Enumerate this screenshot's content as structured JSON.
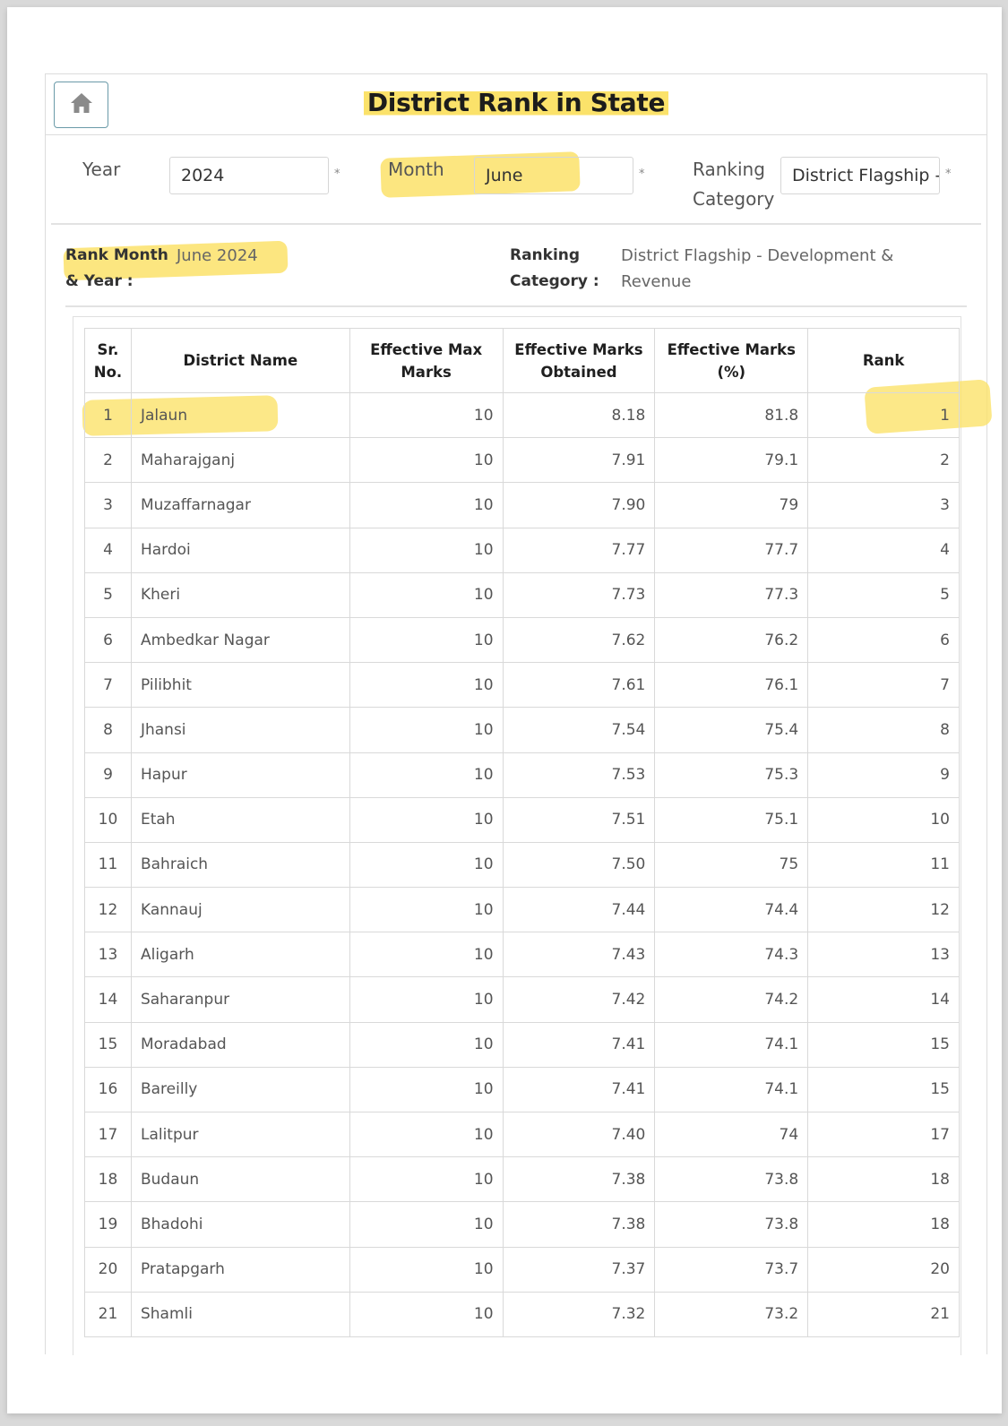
{
  "header": {
    "title": "District Rank in State",
    "home_icon": "home-icon"
  },
  "filters": {
    "year_label": "Year",
    "year_value": "2024",
    "month_label": "Month",
    "month_value": "June",
    "category_label_line1": "Ranking",
    "category_label_line2": "Category",
    "category_value": "District Flagship -",
    "required_mark": "*"
  },
  "summary": {
    "rank_label_line1": "Rank Month",
    "rank_label_line2": "& Year :",
    "rank_value": "June 2024",
    "category_label_line1": "Ranking",
    "category_label_line2": "Category :",
    "category_value": "District Flagship - Development & Revenue"
  },
  "table": {
    "columns": [
      {
        "line1": "Sr.",
        "line2": "No."
      },
      {
        "line1": "District Name",
        "line2": ""
      },
      {
        "line1": "Effective Max",
        "line2": "Marks"
      },
      {
        "line1": "Effective Marks",
        "line2": "Obtained"
      },
      {
        "line1": "Effective Marks",
        "line2": "(%)"
      },
      {
        "line1": "Rank",
        "line2": ""
      }
    ],
    "rows": [
      {
        "sr": "1",
        "district": "Jalaun",
        "max": "10",
        "obtained": "8.18",
        "percent": "81.8",
        "rank": "1"
      },
      {
        "sr": "2",
        "district": "Maharajganj",
        "max": "10",
        "obtained": "7.91",
        "percent": "79.1",
        "rank": "2"
      },
      {
        "sr": "3",
        "district": "Muzaffarnagar",
        "max": "10",
        "obtained": "7.90",
        "percent": "79",
        "rank": "3"
      },
      {
        "sr": "4",
        "district": "Hardoi",
        "max": "10",
        "obtained": "7.77",
        "percent": "77.7",
        "rank": "4"
      },
      {
        "sr": "5",
        "district": "Kheri",
        "max": "10",
        "obtained": "7.73",
        "percent": "77.3",
        "rank": "5"
      },
      {
        "sr": "6",
        "district": "Ambedkar Nagar",
        "max": "10",
        "obtained": "7.62",
        "percent": "76.2",
        "rank": "6"
      },
      {
        "sr": "7",
        "district": "Pilibhit",
        "max": "10",
        "obtained": "7.61",
        "percent": "76.1",
        "rank": "7"
      },
      {
        "sr": "8",
        "district": "Jhansi",
        "max": "10",
        "obtained": "7.54",
        "percent": "75.4",
        "rank": "8"
      },
      {
        "sr": "9",
        "district": "Hapur",
        "max": "10",
        "obtained": "7.53",
        "percent": "75.3",
        "rank": "9"
      },
      {
        "sr": "10",
        "district": "Etah",
        "max": "10",
        "obtained": "7.51",
        "percent": "75.1",
        "rank": "10"
      },
      {
        "sr": "11",
        "district": "Bahraich",
        "max": "10",
        "obtained": "7.50",
        "percent": "75",
        "rank": "11"
      },
      {
        "sr": "12",
        "district": "Kannauj",
        "max": "10",
        "obtained": "7.44",
        "percent": "74.4",
        "rank": "12"
      },
      {
        "sr": "13",
        "district": "Aligarh",
        "max": "10",
        "obtained": "7.43",
        "percent": "74.3",
        "rank": "13"
      },
      {
        "sr": "14",
        "district": "Saharanpur",
        "max": "10",
        "obtained": "7.42",
        "percent": "74.2",
        "rank": "14"
      },
      {
        "sr": "15",
        "district": "Moradabad",
        "max": "10",
        "obtained": "7.41",
        "percent": "74.1",
        "rank": "15"
      },
      {
        "sr": "16",
        "district": "Bareilly",
        "max": "10",
        "obtained": "7.41",
        "percent": "74.1",
        "rank": "15"
      },
      {
        "sr": "17",
        "district": "Lalitpur",
        "max": "10",
        "obtained": "7.40",
        "percent": "74",
        "rank": "17"
      },
      {
        "sr": "18",
        "district": "Budaun",
        "max": "10",
        "obtained": "7.38",
        "percent": "73.8",
        "rank": "18"
      },
      {
        "sr": "19",
        "district": "Bhadohi",
        "max": "10",
        "obtained": "7.38",
        "percent": "73.8",
        "rank": "18"
      },
      {
        "sr": "20",
        "district": "Pratapgarh",
        "max": "10",
        "obtained": "7.37",
        "percent": "73.7",
        "rank": "20"
      },
      {
        "sr": "21",
        "district": "Shamli",
        "max": "10",
        "obtained": "7.32",
        "percent": "73.2",
        "rank": "21"
      }
    ]
  },
  "colors": {
    "highlight": "#fbe26a",
    "home_button_border": "#6a9aa8",
    "home_icon": "#8a8a8a"
  }
}
